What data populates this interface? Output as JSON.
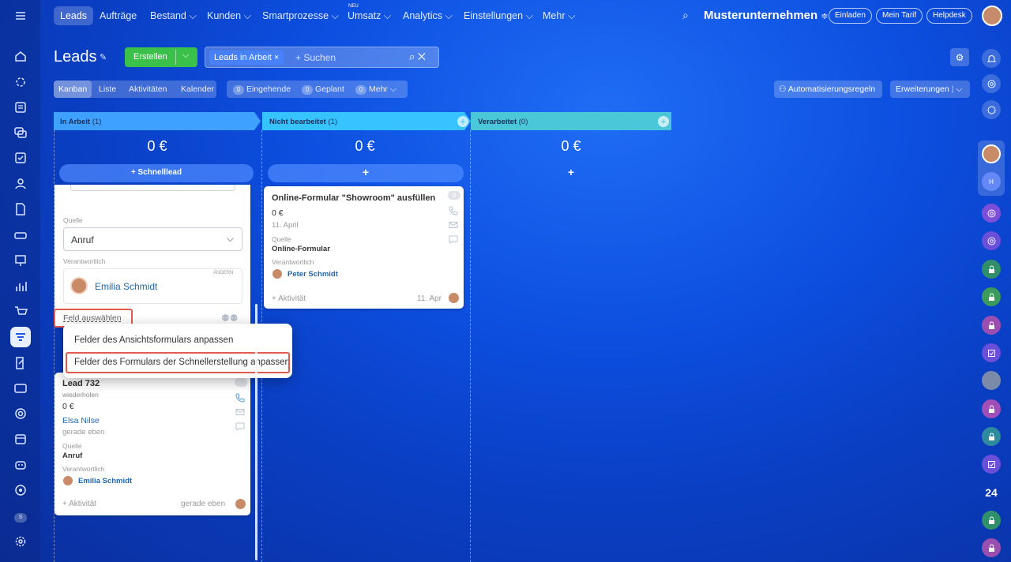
{
  "nav": {
    "items": [
      "Leads",
      "Aufträge",
      "Bestand",
      "Kunden",
      "Smartprozesse",
      "Umsatz",
      "Analytics",
      "Einstellungen",
      "Mehr"
    ],
    "new_badge": "NEU",
    "company": "Musterunternehmen",
    "invite": "Einladen",
    "plan": "Mein Tarif",
    "help": "Helpdesk"
  },
  "header": {
    "title": "Leads",
    "create_label": "Erstellen",
    "filter_chip": "Leads in Arbeit",
    "search_placeholder": "+ Suchen"
  },
  "views": {
    "tabs": [
      "Kanban",
      "Liste",
      "Aktivitäten",
      "Kalender"
    ],
    "counters": [
      {
        "count": "0",
        "label": "Eingehende"
      },
      {
        "count": "0",
        "label": "Geplant"
      },
      {
        "count": "0",
        "label": "Mehr"
      }
    ],
    "automation": "Automatisierungsregeln",
    "extensions": "Erweiterungen"
  },
  "columns": [
    {
      "name": "In Arbeit",
      "count": "(1)",
      "sum": "0 €",
      "quick": "+ Schnelllead",
      "color": "#3ea0ff"
    },
    {
      "name": "Nicht bearbeitet",
      "count": "(1)",
      "sum": "0 €",
      "quick": "+",
      "color": "#36c3ff"
    },
    {
      "name": "Verarbeitet",
      "count": "(0)",
      "sum": "0 €",
      "quick": "+",
      "color": "#4ac7d8"
    }
  ],
  "quick_form": {
    "source_label": "Quelle",
    "source_value": "Anruf",
    "responsible_label": "Verantwortlich",
    "change_label": "ÄNDERN",
    "responsible_name": "Emilia Schmidt",
    "select_field": "Feld auswählen"
  },
  "menu": {
    "item1": "Felder des Ansichtsformulars anpassen",
    "item2": "Felder des Formulars der Schnellerstellung anpassen"
  },
  "lead_card": {
    "title": "Lead 732",
    "subtitle": "wiederholen",
    "amount": "0 €",
    "contact": "Elsa Nilse",
    "time": "gerade eben",
    "source_label": "Quelle",
    "source": "Anruf",
    "responsible_label": "Verantwortlich",
    "responsible": "Emilia Schmidt",
    "activity": "+ Aktivität",
    "footer_time": "gerade eben"
  },
  "form_card": {
    "title": "Online-Formular \"Showroom\" ausfüllen",
    "badge": "0",
    "amount": "0 €",
    "date": "11. April",
    "source_label": "Quelle",
    "source": "Online-Formular",
    "responsible_label": "Verantwortlich",
    "responsible": "Peter Schmidt",
    "activity": "+ Aktivität",
    "footer_date": "11. Apr"
  },
  "rightbar": {
    "number_badge": "24",
    "user_initial": "H"
  },
  "leftbar": {
    "user_initial": "S"
  }
}
